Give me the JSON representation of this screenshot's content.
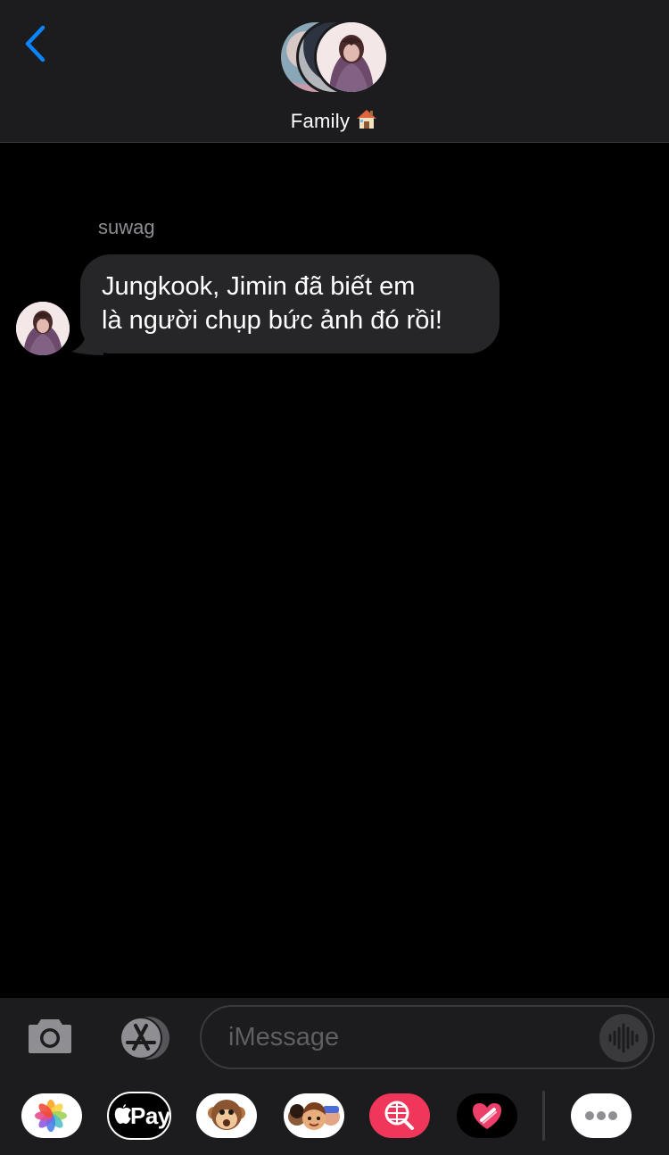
{
  "header": {
    "group_name": "Family",
    "group_emoji": "house-emoji"
  },
  "messages": [
    {
      "sender": "suwag",
      "lines": [
        "Jungkook, Jimin đã biết em",
        "là người chụp bức ảnh đó rồi!"
      ]
    }
  ],
  "composer": {
    "placeholder": "iMessage"
  },
  "app_tray": {
    "apple_pay_label": "Pay",
    "items": [
      "photos-app",
      "apple-pay-app",
      "animoji-app",
      "memoji-app",
      "image-search-app",
      "digital-touch-app",
      "more-apps"
    ]
  },
  "colors": {
    "accent": "#0a84ff",
    "header_bg": "#1c1c1e",
    "bubble_received": "#262629",
    "image_search": "#f0375b"
  }
}
